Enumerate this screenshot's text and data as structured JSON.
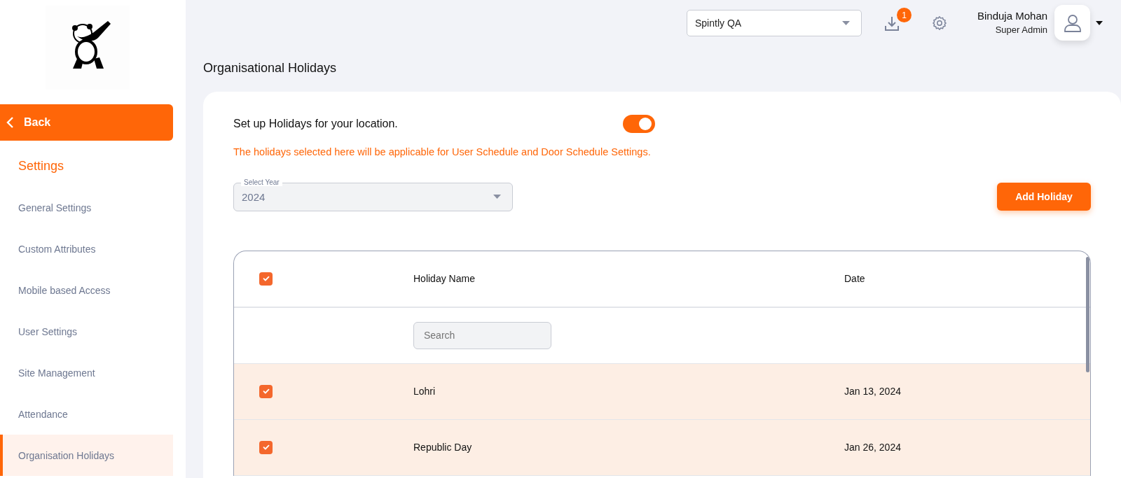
{
  "sidebar": {
    "back": {
      "label": "Back"
    },
    "section_title": "Settings",
    "items": [
      {
        "label": "General Settings",
        "selected": false
      },
      {
        "label": "Custom Attributes",
        "selected": false
      },
      {
        "label": "Mobile based Access",
        "selected": false
      },
      {
        "label": "User Settings",
        "selected": false
      },
      {
        "label": "Site Management",
        "selected": false
      },
      {
        "label": "Attendance",
        "selected": false
      },
      {
        "label": "Organisation Holidays",
        "selected": true
      }
    ]
  },
  "topbar": {
    "site_select": {
      "value": "Spintly QA"
    },
    "downloads_badge": "1",
    "user": {
      "name": "Binduja Mohan",
      "role": "Super Admin"
    }
  },
  "page_title": "Organisational Holidays",
  "card": {
    "setup_label": "Set up Holidays for your location.",
    "holidays_enabled": true,
    "note": "The holidays selected here will be applicable for User Schedule and Door Schedule Settings.",
    "year_select": {
      "label": "Select Year",
      "value": "2024"
    },
    "add_button": "Add Holiday",
    "table": {
      "select_all_checked": true,
      "columns": [
        "Holiday Name",
        "Date"
      ],
      "search": {
        "placeholder": "Search"
      },
      "rows": [
        {
          "name": "Lohri",
          "date": "Jan 13, 2024",
          "selected": true
        },
        {
          "name": "Republic Day",
          "date": "Jan 26, 2024",
          "selected": true
        }
      ]
    }
  }
}
